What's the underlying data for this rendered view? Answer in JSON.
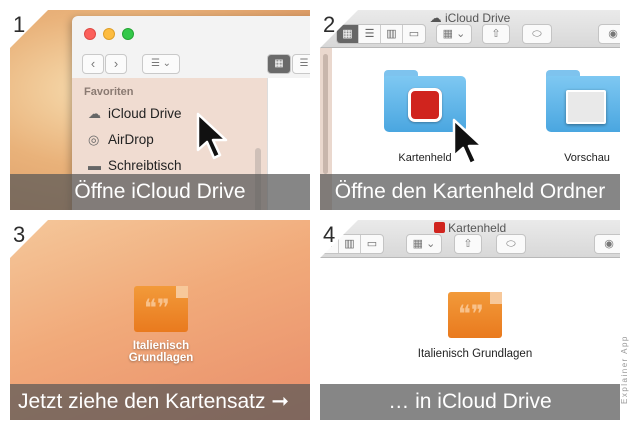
{
  "panels": [
    {
      "step": "1",
      "caption": "Öffne iCloud Drive",
      "sidebar": {
        "heading": "Favoriten",
        "items": [
          {
            "label": "iCloud Drive",
            "icon": "cloud-icon"
          },
          {
            "label": "AirDrop",
            "icon": "airdrop-icon"
          },
          {
            "label": "Schreibtisch",
            "icon": "desktop-icon"
          }
        ]
      }
    },
    {
      "step": "2",
      "caption": "Öffne den Kartenheld Ordner",
      "window_title": "iCloud Drive",
      "folders": [
        {
          "label": "Kartenheld",
          "badge": "kartenheld-app-icon"
        },
        {
          "label": "Vorschau",
          "badge": "preview-app-icon"
        }
      ]
    },
    {
      "step": "3",
      "caption": "Jetzt ziehe den Kartensatz ➞",
      "file": {
        "line1": "Italienisch",
        "line2": "Grundlagen"
      }
    },
    {
      "step": "4",
      "caption": "… in iCloud Drive",
      "window_title": "Kartenheld",
      "file": {
        "label": "Italienisch Grundlagen"
      }
    }
  ],
  "credit": "Explainer App",
  "colors": {
    "caption_bg": "#585858",
    "folder_blue": "#5ab4e8",
    "deck_orange": "#ec8624"
  }
}
